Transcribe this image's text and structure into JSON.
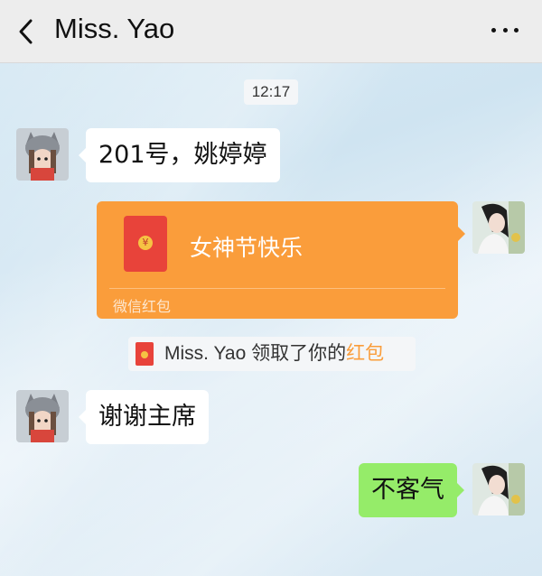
{
  "header": {
    "title": "Miss. Yao",
    "back_icon": "chevron-left-icon",
    "more_icon": "ellipsis-icon"
  },
  "chat": {
    "timestamp": "12:17",
    "messages": [
      {
        "sender": "other",
        "type": "text",
        "text": "201号，姚婷婷"
      },
      {
        "sender": "self",
        "type": "red_packet",
        "greeting": "女神节快乐",
        "footer": "微信红包"
      },
      {
        "sender": "system",
        "type": "notice",
        "prefix": "Miss. Yao 领取了你的",
        "link": "红包"
      },
      {
        "sender": "other",
        "type": "text",
        "text": "谢谢主席"
      },
      {
        "sender": "self",
        "type": "text",
        "text": "不客气"
      }
    ]
  },
  "colors": {
    "header_bg": "#ededed",
    "self_bubble": "#95ec69",
    "other_bubble": "#ffffff",
    "red_packet": "#fa9d3b",
    "link": "#fa9d3b"
  }
}
